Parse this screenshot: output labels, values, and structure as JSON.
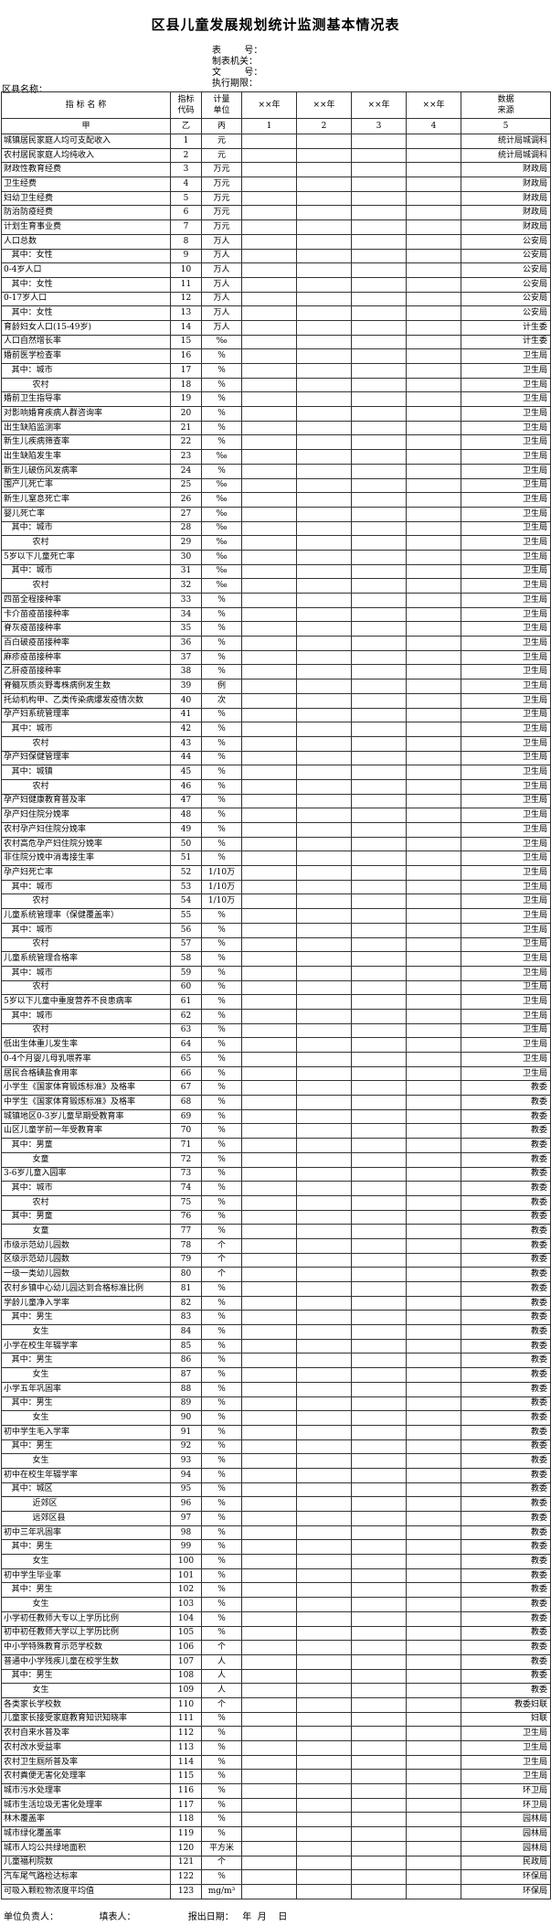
{
  "title": "区县儿童发展规划统计监测基本情况表",
  "form_info": {
    "table_no": "表        号：",
    "issuer": "制表机关：",
    "doc_no": "文        号：",
    "period": "执行期限："
  },
  "region_label": "区县名称：",
  "headers": {
    "name": "指   标   名   称",
    "code": "指标\n代码",
    "unit": "计量\n单位",
    "years": [
      "××年",
      "××年",
      "××年",
      "××年"
    ],
    "source": "数据\n来源"
  },
  "index_row": [
    "甲",
    "乙",
    "丙",
    "1",
    "2",
    "3",
    "4",
    "5"
  ],
  "rows": [
    [
      "城镇居民家庭人均可支配收入",
      "1",
      "元",
      "统计局城调科"
    ],
    [
      "农村居民家庭人均纯收入",
      "2",
      "元",
      "统计局城调科"
    ],
    [
      "财政性教育经费",
      "3",
      "万元",
      "财政局"
    ],
    [
      "卫生经费",
      "4",
      "万元",
      "财政局"
    ],
    [
      "妇幼卫生经费",
      "5",
      "万元",
      "财政局"
    ],
    [
      "防治防疫经费",
      "6",
      "万元",
      "财政局"
    ],
    [
      "计划生育事业费",
      "7",
      "万元",
      "财政局"
    ],
    [
      "人口总数",
      "8",
      "万人",
      "公安局"
    ],
    [
      "   其中：女性",
      "9",
      "万人",
      "公安局"
    ],
    [
      "0-4岁人口",
      "10",
      "万人",
      "公安局"
    ],
    [
      "   其中：女性",
      "11",
      "万人",
      "公安局"
    ],
    [
      "0-17岁人口",
      "12",
      "万人",
      "公安局"
    ],
    [
      "   其中：女性",
      "13",
      "万人",
      "公安局"
    ],
    [
      "育龄妇女人口(15-49岁)",
      "14",
      "万人",
      "计生委"
    ],
    [
      "人口自然增长率",
      "15",
      "‰",
      "计生委"
    ],
    [
      "婚前医学检查率",
      "16",
      "%",
      "卫生局"
    ],
    [
      "   其中：城市",
      "17",
      "%",
      "卫生局"
    ],
    [
      "           农村",
      "18",
      "%",
      "卫生局"
    ],
    [
      "婚前卫生指导率",
      "19",
      "%",
      "卫生局"
    ],
    [
      "对影响婚育疾病人群咨询率",
      "20",
      "%",
      "卫生局"
    ],
    [
      "出生缺陷监测率",
      "21",
      "%",
      "卫生局"
    ],
    [
      "新生儿疾病筛查率",
      "22",
      "%",
      "卫生局"
    ],
    [
      "出生缺陷发生率",
      "23",
      "‰",
      "卫生局"
    ],
    [
      "新生儿破伤风发病率",
      "24",
      "%",
      "卫生局"
    ],
    [
      "围产儿死亡率",
      "25",
      "‰",
      "卫生局"
    ],
    [
      "新生儿窒息死亡率",
      "26",
      "‰",
      "卫生局"
    ],
    [
      "婴儿死亡率",
      "27",
      "‰",
      "卫生局"
    ],
    [
      "   其中：城市",
      "28",
      "‰",
      "卫生局"
    ],
    [
      "           农村",
      "29",
      "‰",
      "卫生局"
    ],
    [
      "5岁以下儿童死亡率",
      "30",
      "‰",
      "卫生局"
    ],
    [
      "   其中：城市",
      "31",
      "‰",
      "卫生局"
    ],
    [
      "           农村",
      "32",
      "‰",
      "卫生局"
    ],
    [
      "四苗全程接种率",
      "33",
      "%",
      "卫生局"
    ],
    [
      "卡介苗疫苗接种率",
      "34",
      "%",
      "卫生局"
    ],
    [
      "脊灰疫苗接种率",
      "35",
      "%",
      "卫生局"
    ],
    [
      "百白破疫苗接种率",
      "36",
      "%",
      "卫生局"
    ],
    [
      "麻疹疫苗接种率",
      "37",
      "%",
      "卫生局"
    ],
    [
      "乙肝疫苗接种率",
      "38",
      "%",
      "卫生局"
    ],
    [
      "脊髓灰质炎野毒株病例发生数",
      "39",
      "例",
      "卫生局"
    ],
    [
      "托幼机构甲、乙类传染病爆发疫情次数",
      "40",
      "次",
      "卫生局"
    ],
    [
      "孕产妇系统管理率",
      "41",
      "%",
      "卫生局"
    ],
    [
      "   其中：城市",
      "42",
      "%",
      "卫生局"
    ],
    [
      "           农村",
      "43",
      "%",
      "卫生局"
    ],
    [
      "孕产妇保健管理率",
      "44",
      "%",
      "卫生局"
    ],
    [
      "   其中：城镇",
      "45",
      "%",
      "卫生局"
    ],
    [
      "           农村",
      "46",
      "%",
      "卫生局"
    ],
    [
      "孕产妇健康教育普及率",
      "47",
      "%",
      "卫生局"
    ],
    [
      "孕产妇住院分娩率",
      "48",
      "%",
      "卫生局"
    ],
    [
      "农村孕产妇住院分娩率",
      "49",
      "%",
      "卫生局"
    ],
    [
      "农村高危孕产妇住院分娩率",
      "50",
      "%",
      "卫生局"
    ],
    [
      "非住院分娩中消毒接生率",
      "51",
      "%",
      "卫生局"
    ],
    [
      "孕产妇死亡率",
      "52",
      "1/10万",
      "卫生局"
    ],
    [
      "   其中：城市",
      "53",
      "1/10万",
      "卫生局"
    ],
    [
      "           农村",
      "54",
      "1/10万",
      "卫生局"
    ],
    [
      "儿童系统管理率（保健覆盖率）",
      "55",
      "%",
      "卫生局"
    ],
    [
      "   其中：城市",
      "56",
      "%",
      "卫生局"
    ],
    [
      "           农村",
      "57",
      "%",
      "卫生局"
    ],
    [
      "儿童系统管理合格率",
      "58",
      "%",
      "卫生局"
    ],
    [
      "   其中：城市",
      "59",
      "%",
      "卫生局"
    ],
    [
      "           农村",
      "60",
      "%",
      "卫生局"
    ],
    [
      "5岁以下儿童中重度营养不良患病率",
      "61",
      "%",
      "卫生局"
    ],
    [
      "   其中：城市",
      "62",
      "%",
      "卫生局"
    ],
    [
      "           农村",
      "63",
      "%",
      "卫生局"
    ],
    [
      "低出生体重儿发生率",
      "64",
      "%",
      "卫生局"
    ],
    [
      "0-4个月婴儿母乳喂养率",
      "65",
      "%",
      "卫生局"
    ],
    [
      "居民合格碘盐食用率",
      "66",
      "%",
      "卫生局"
    ],
    [
      "小学生《国家体育锻炼标准》及格率",
      "67",
      "%",
      "教委"
    ],
    [
      "中学生《国家体育锻炼标准》及格率",
      "68",
      "%",
      "教委"
    ],
    [
      "城镇地区0-3岁儿童早期受教育率",
      "69",
      "%",
      "教委"
    ],
    [
      "山区儿童学前一年受教育率",
      "70",
      "%",
      "教委"
    ],
    [
      "   其中：男童",
      "71",
      "%",
      "教委"
    ],
    [
      "           女童",
      "72",
      "%",
      "教委"
    ],
    [
      "3-6岁儿童入园率",
      "73",
      "%",
      "教委"
    ],
    [
      "   其中：城市",
      "74",
      "%",
      "教委"
    ],
    [
      "           农村",
      "75",
      "%",
      "教委"
    ],
    [
      "   其中：男童",
      "76",
      "%",
      "教委"
    ],
    [
      "           女童",
      "77",
      "%",
      "教委"
    ],
    [
      "市级示范幼儿园数",
      "78",
      "个",
      "教委"
    ],
    [
      "区级示范幼儿园数",
      "79",
      "个",
      "教委"
    ],
    [
      "一级一类幼儿园数",
      "80",
      "个",
      "教委"
    ],
    [
      "农村乡镇中心幼儿园达到合格标准比例",
      "81",
      "%",
      "教委"
    ],
    [
      "学龄儿童净入学率",
      "82",
      "%",
      "教委"
    ],
    [
      "   其中：男生",
      "83",
      "%",
      "教委"
    ],
    [
      "           女生",
      "84",
      "%",
      "教委"
    ],
    [
      "小学在校生年辍学率",
      "85",
      "%",
      "教委"
    ],
    [
      "   其中：男生",
      "86",
      "%",
      "教委"
    ],
    [
      "           女生",
      "87",
      "%",
      "教委"
    ],
    [
      "小学五年巩固率",
      "88",
      "%",
      "教委"
    ],
    [
      "   其中：男生",
      "89",
      "%",
      "教委"
    ],
    [
      "           女生",
      "90",
      "%",
      "教委"
    ],
    [
      "初中学生毛入学率",
      "91",
      "%",
      "教委"
    ],
    [
      "   其中：男生",
      "92",
      "%",
      "教委"
    ],
    [
      "           女生",
      "93",
      "%",
      "教委"
    ],
    [
      "初中在校生年辍学率",
      "94",
      "%",
      "教委"
    ],
    [
      "   其中：城区",
      "95",
      "%",
      "教委"
    ],
    [
      "           近郊区",
      "96",
      "%",
      "教委"
    ],
    [
      "           远郊区县",
      "97",
      "%",
      "教委"
    ],
    [
      "初中三年巩固率",
      "98",
      "%",
      "教委"
    ],
    [
      "   其中：男生",
      "99",
      "%",
      "教委"
    ],
    [
      "           女生",
      "100",
      "%",
      "教委"
    ],
    [
      "初中学生毕业率",
      "101",
      "%",
      "教委"
    ],
    [
      "   其中：男生",
      "102",
      "%",
      "教委"
    ],
    [
      "           女生",
      "103",
      "%",
      "教委"
    ],
    [
      "小学初任教师大专以上学历比例",
      "104",
      "%",
      "教委"
    ],
    [
      "初中初任教师大学以上学历比例",
      "105",
      "%",
      "教委"
    ],
    [
      "中小学特殊教育示范学校数",
      "106",
      "个",
      "教委"
    ],
    [
      "普通中小学残疾儿童在校学生数",
      "107",
      "人",
      "教委"
    ],
    [
      "   其中：男生",
      "108",
      "人",
      "教委"
    ],
    [
      "           女生",
      "109",
      "人",
      "教委"
    ],
    [
      "各类家长学校数",
      "110",
      "个",
      "教委妇联"
    ],
    [
      "儿童家长接受家庭教育知识知晓率",
      "111",
      "%",
      "妇联"
    ],
    [
      "农村自来水普及率",
      "112",
      "%",
      "卫生局"
    ],
    [
      "农村改水受益率",
      "113",
      "%",
      "卫生局"
    ],
    [
      "农村卫生厕所普及率",
      "114",
      "%",
      "卫生局"
    ],
    [
      "农村粪便无害化处理率",
      "115",
      "%",
      "卫生局"
    ],
    [
      "城市污水处理率",
      "116",
      "%",
      "环卫局"
    ],
    [
      "城市生活垃圾无害化处理率",
      "117",
      "%",
      "环卫局"
    ],
    [
      "林木覆盖率",
      "118",
      "%",
      "园林局"
    ],
    [
      "城市绿化覆盖率",
      "119",
      "%",
      "园林局"
    ],
    [
      "城市人均公共绿地面积",
      "120",
      "平方米",
      "园林局"
    ],
    [
      "儿童福利院数",
      "121",
      "个",
      "民政局"
    ],
    [
      "汽车尾气路检达标率",
      "122",
      "%",
      "环保局"
    ],
    [
      "可吸入颗粒物浓度平均值",
      "123",
      "mg/m³",
      "环保局"
    ]
  ],
  "footer": {
    "responsible": "单位负责人：",
    "filler": "填表人：",
    "report_date": "报出日期：   年  月    日"
  }
}
